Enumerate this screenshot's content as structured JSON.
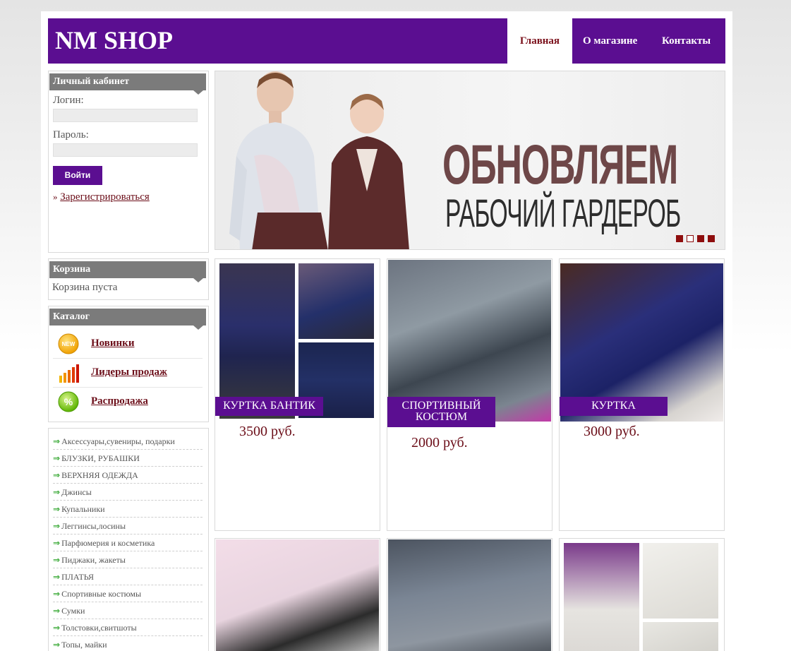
{
  "header": {
    "logo": "NM SHOP",
    "nav": [
      "Главная",
      "О магазине",
      "Контакты"
    ]
  },
  "account": {
    "title": "Личный кабинет",
    "login_label": "Логин:",
    "password_label": "Пароль:",
    "login_value": "",
    "password_value": "",
    "submit": "Войти",
    "register_prefix": "»",
    "register": "Зарегистрироваться"
  },
  "cart": {
    "title": "Корзина",
    "status": "Корзина пуста"
  },
  "catalog": {
    "title": "Каталог",
    "items": [
      {
        "label": "Новинки",
        "icon": "new-badge-icon"
      },
      {
        "label": "Лидеры продаж",
        "icon": "bar-chart-icon"
      },
      {
        "label": "Распродажа",
        "icon": "percent-icon"
      }
    ]
  },
  "categories": [
    "Аксессуары,сувениры, подарки",
    "БЛУЗКИ, РУБАШКИ",
    "ВЕРХНЯЯ ОДЕЖДА",
    "Джинсы",
    "Купальники",
    "Леггинсы,лосины",
    "Парфюмерия и косметика",
    "Пиджаки, жакеты",
    "ПЛАТЬЯ",
    "Спортивные костюмы",
    "Сумки",
    "Толстовки,свитшоты",
    "Топы, майки"
  ],
  "banner": {
    "title": "ОБНОВЛЯЕМ",
    "subtitle": "РАБОЧИЙ ГАРДЕРОБ",
    "slides": 4,
    "active_slide": 2
  },
  "products": [
    {
      "title": "КУРТКА БАНТИК",
      "price": "3500 руб."
    },
    {
      "title_line1": "СПОРТИВНЫЙ",
      "title_line2": "КОСТЮМ",
      "price": "2000 руб."
    },
    {
      "title": "КУРТКА",
      "price": "3000 руб."
    }
  ],
  "colors": {
    "brand": "#5b0e91",
    "link": "#6b0d18",
    "box_header": "#7b7b7b"
  }
}
